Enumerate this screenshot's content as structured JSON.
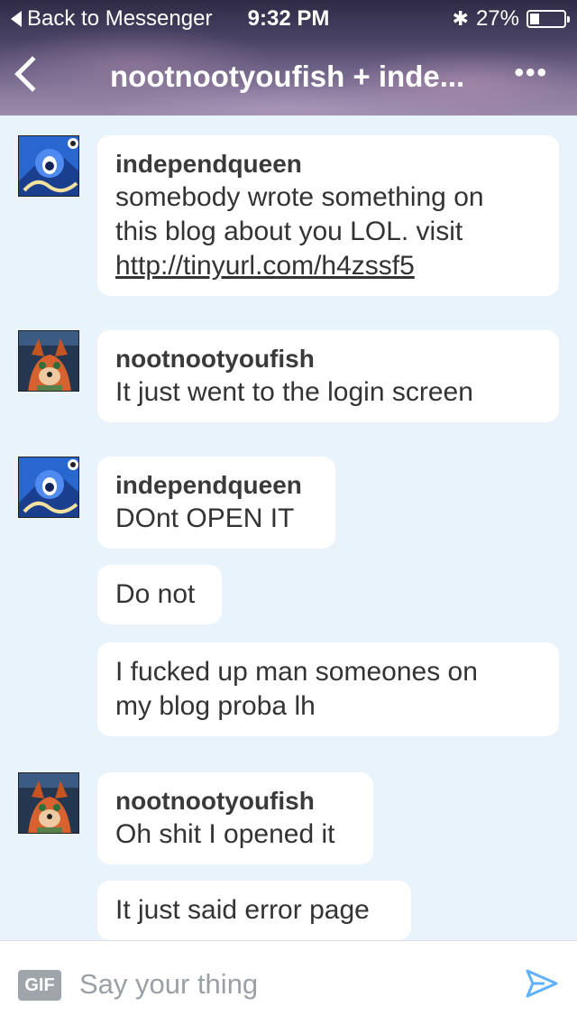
{
  "status_bar": {
    "back_label": "Back to Messenger",
    "time": "9:32 PM",
    "battery_percent_label": "27%",
    "battery_level": 0.27
  },
  "header": {
    "title": "nootnootyoufish + inde..."
  },
  "messages": [
    {
      "sender": "independqueen",
      "lines": [
        "somebody wrote something on",
        "this blog about you LOL. visit"
      ],
      "link": "http://tinyurl.com/h4zssf5"
    },
    {
      "sender": "nootnootyoufish",
      "text": "It just went to the login screen"
    },
    {
      "sender": "independqueen",
      "text": "DOnt OPEN IT"
    },
    {
      "text": "Do not"
    },
    {
      "lines": [
        "I fucked up man someones on",
        "my blog proba lh"
      ]
    },
    {
      "sender": "nootnootyoufish",
      "text": "Oh shit I opened it"
    },
    {
      "text": "It just said error page"
    }
  ],
  "composer": {
    "gif_label": "GIF",
    "placeholder": "Say your thing"
  },
  "colors": {
    "chat_background": "#e9f3fb",
    "send_icon": "#5fb0ff"
  }
}
